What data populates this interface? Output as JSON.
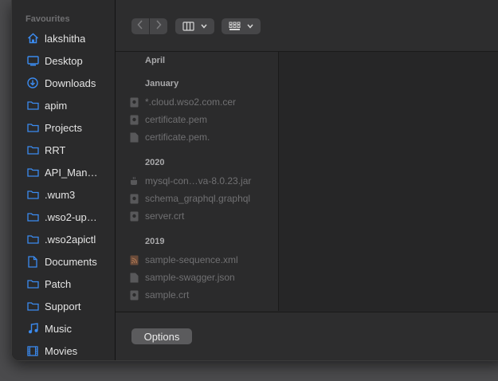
{
  "sidebar": {
    "section_title": "Favourites",
    "items": [
      {
        "label": "lakshitha",
        "icon": "home-icon"
      },
      {
        "label": "Desktop",
        "icon": "desktop-icon"
      },
      {
        "label": "Downloads",
        "icon": "download-icon"
      },
      {
        "label": "apim",
        "icon": "folder-icon"
      },
      {
        "label": "Projects",
        "icon": "folder-icon"
      },
      {
        "label": "RRT",
        "icon": "folder-icon"
      },
      {
        "label": "API_Man…",
        "icon": "folder-icon"
      },
      {
        "label": ".wum3",
        "icon": "folder-icon"
      },
      {
        "label": ".wso2-up…",
        "icon": "folder-icon"
      },
      {
        "label": ".wso2apictl",
        "icon": "folder-icon"
      },
      {
        "label": "Documents",
        "icon": "document-icon"
      },
      {
        "label": "Patch",
        "icon": "folder-icon"
      },
      {
        "label": "Support",
        "icon": "folder-icon"
      },
      {
        "label": "Music",
        "icon": "music-icon"
      },
      {
        "label": "Movies",
        "icon": "film-icon"
      }
    ]
  },
  "toolbar": {
    "back_icon": "chevron-left-icon",
    "forward_icon": "chevron-right-icon",
    "view_mode_icon": "columns-view-icon",
    "group_icon": "grid-group-icon"
  },
  "files": {
    "groups": [
      {
        "title": "April",
        "items": []
      },
      {
        "title": "January",
        "items": [
          {
            "name": "*.cloud.wso2.com.cer",
            "icon": "certificate-icon"
          },
          {
            "name": "certificate.pem",
            "icon": "certificate-icon"
          },
          {
            "name": "certificate.pem.",
            "icon": "blank-file-icon"
          }
        ]
      },
      {
        "title": "2020",
        "items": [
          {
            "name": "mysql-con…va-8.0.23.jar",
            "icon": "jar-icon"
          },
          {
            "name": "schema_graphql.graphql",
            "icon": "certificate-icon"
          },
          {
            "name": "server.crt",
            "icon": "certificate-icon"
          }
        ]
      },
      {
        "title": "2019",
        "items": [
          {
            "name": "sample-sequence.xml",
            "icon": "xml-feed-icon"
          },
          {
            "name": "sample-swagger.json",
            "icon": "blank-file-icon"
          },
          {
            "name": "sample.crt",
            "icon": "certificate-icon"
          }
        ]
      }
    ]
  },
  "footer": {
    "options_label": "Options"
  },
  "colors": {
    "accent": "#3b8bf0",
    "sidebar_bg": "#2a2a2b",
    "window_bg": "#262627"
  }
}
